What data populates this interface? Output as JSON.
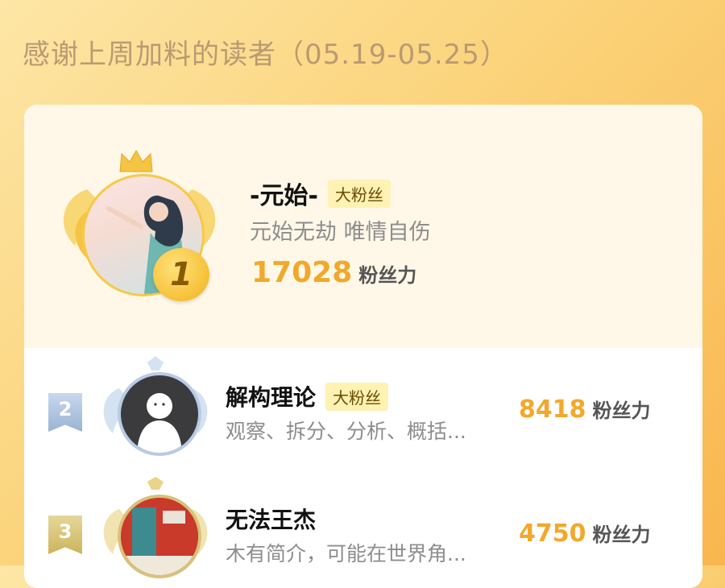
{
  "header": {
    "title": "感谢上周加料的读者（05.19-05.25）"
  },
  "readers": [
    {
      "rank": "1",
      "name": "-元始-",
      "badge": "大粉丝",
      "bio": "元始无劫 唯情自伤",
      "score": "17028",
      "score_unit": "粉丝力"
    },
    {
      "rank": "2",
      "name": "解构理论",
      "badge": "大粉丝",
      "bio": "观察、拆分、分析、概括...",
      "score": "8418",
      "score_unit": "粉丝力"
    },
    {
      "rank": "3",
      "name": "无法王杰",
      "badge": "",
      "bio": "木有简介，可能在世界角...",
      "score": "4750",
      "score_unit": "粉丝力"
    }
  ],
  "colors": {
    "score": "#f2a82a",
    "badge_bg": "#fff2b3",
    "gold": "#f6c443",
    "silver": "#b7c9e2",
    "bronze": "#d8c27a"
  }
}
